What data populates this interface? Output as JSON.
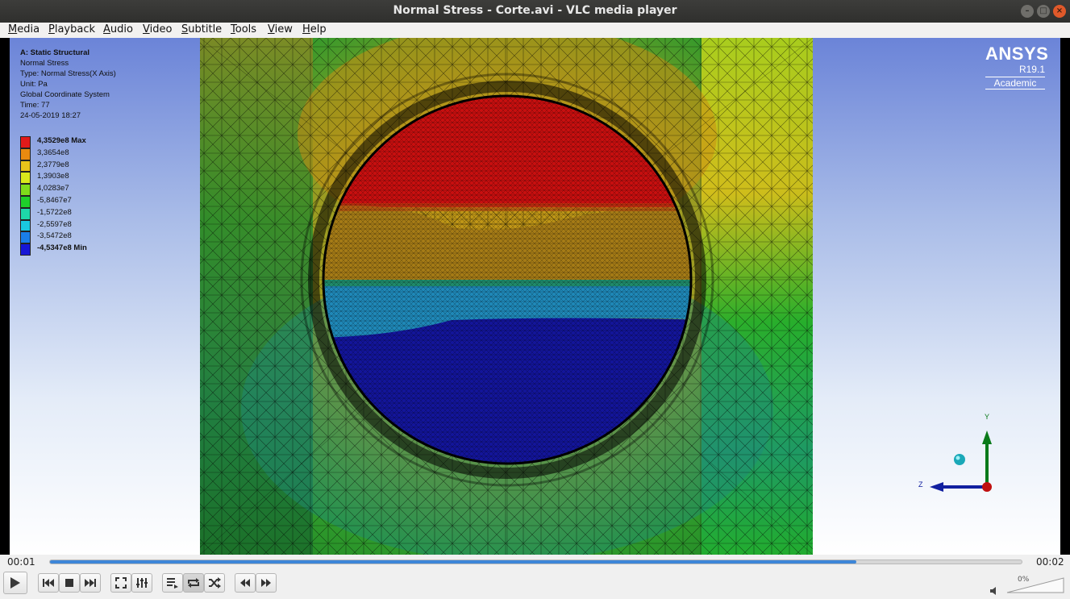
{
  "window": {
    "title": "Normal Stress - Corte.avi - VLC media player"
  },
  "menu": {
    "items": [
      {
        "mnemonic": "M",
        "rest": "edia"
      },
      {
        "mnemonic": "P",
        "rest": "layback"
      },
      {
        "mnemonic": "A",
        "rest": "udio"
      },
      {
        "mnemonic": "V",
        "rest": "ideo"
      },
      {
        "mnemonic": "S",
        "rest": "ubtitle"
      },
      {
        "mnemonic": "T",
        "rest": "ools"
      },
      {
        "mnemonic": "V",
        "rest": "iew"
      },
      {
        "mnemonic": "H",
        "rest": "elp"
      }
    ]
  },
  "frame": {
    "info": {
      "heading": "A: Static Structural",
      "lines": [
        "Normal Stress",
        "Type: Normal Stress(X Axis)",
        "Unit: Pa",
        "Global Coordinate System",
        "Time: 77",
        "24-05-2019 18:27"
      ]
    },
    "legend": [
      {
        "label": "4,3529e8 Max",
        "color": "#e21a1a",
        "bold": true
      },
      {
        "label": "3,3654e8",
        "color": "#e98a10"
      },
      {
        "label": "2,3779e8",
        "color": "#e9c41a"
      },
      {
        "label": "1,3903e8",
        "color": "#d9e81c"
      },
      {
        "label": "4,0283e7",
        "color": "#7fdc1b"
      },
      {
        "label": "-5,8467e7",
        "color": "#1fd02a"
      },
      {
        "label": "-1,5722e8",
        "color": "#1ed8a8"
      },
      {
        "label": "-2,5597e8",
        "color": "#1ac8e0"
      },
      {
        "label": "-3,5472e8",
        "color": "#1a7ee8"
      },
      {
        "label": "-4,5347e8 Min",
        "color": "#1616d6",
        "bold": true
      }
    ],
    "brand": {
      "logo": "ANSYS",
      "version": "R19.1",
      "edition": "Academic"
    },
    "triad": {
      "y_label": "Y",
      "z_label": "Z"
    }
  },
  "playback": {
    "elapsed": "00:01",
    "total": "00:02",
    "progress_fraction": 0.83
  },
  "volume": {
    "percent": "0%",
    "level_fraction": 0
  }
}
